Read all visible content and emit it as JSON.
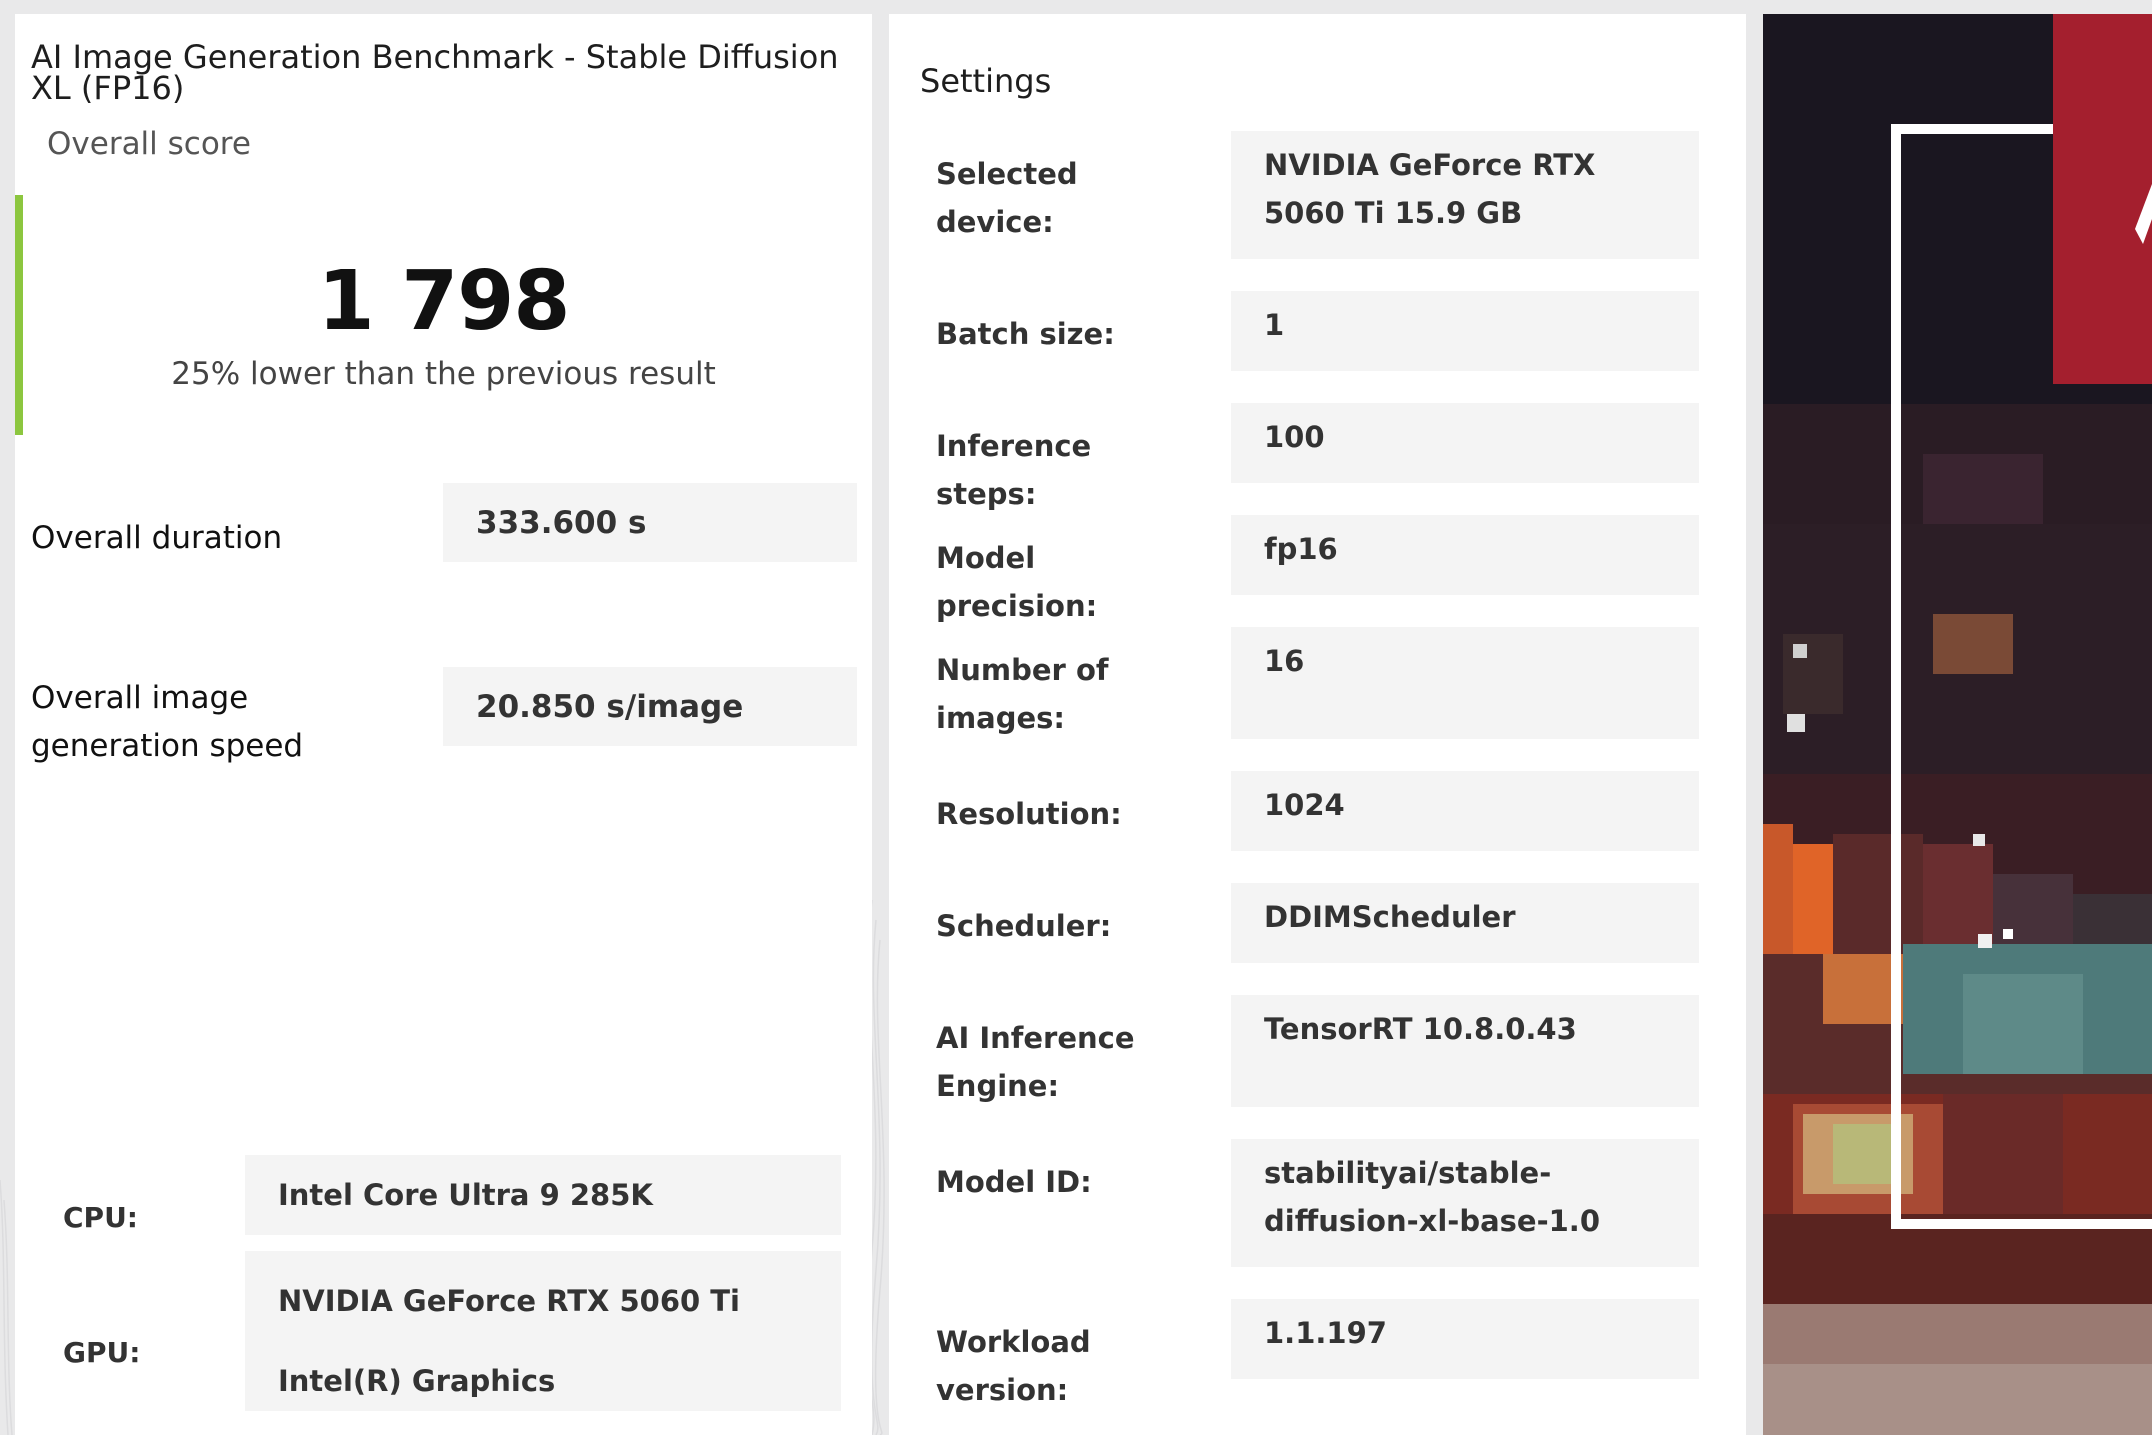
{
  "result": {
    "title": "AI Image Generation Benchmark - Stable Diffusion XL (FP16)",
    "score_label": "Overall score",
    "score": "1 798",
    "comparison": "25% lower than the previous result",
    "accent_color": "#8cc63f",
    "metrics": [
      {
        "label": "Overall duration",
        "value": "333.600 s"
      },
      {
        "label": "Overall image generation speed",
        "value": "20.850 s/image"
      }
    ],
    "hardware": {
      "cpu_label": "CPU:",
      "cpu_value": "Intel Core Ultra 9 285K",
      "gpu_label": "GPU:",
      "gpu_values": [
        "NVIDIA GeForce RTX 5060 Ti",
        "Intel(R) Graphics"
      ]
    }
  },
  "settings": {
    "title": "Settings",
    "rows": [
      {
        "label": "Selected device:",
        "value": "NVIDIA GeForce RTX 5060 Ti 15.9 GB"
      },
      {
        "label": "Batch size:",
        "value": "1"
      },
      {
        "label": "Inference steps:",
        "value": "100"
      },
      {
        "label": "Model precision:",
        "value": "fp16"
      },
      {
        "label": "Number of images:",
        "value": "16"
      },
      {
        "label": "Resolution:",
        "value": "1024"
      },
      {
        "label": "Scheduler:",
        "value": "DDIMScheduler"
      },
      {
        "label": "AI Inference Engine:",
        "value": "TensorRT 10.8.0.43"
      },
      {
        "label": "Model ID:",
        "value": "stabilityai/stable-diffusion-xl-base-1.0"
      },
      {
        "label": "Workload version:",
        "value": "1.1.197"
      }
    ]
  },
  "art": {
    "icon": "pixelated-artwork-image",
    "accent_color": "#a41f2e"
  }
}
